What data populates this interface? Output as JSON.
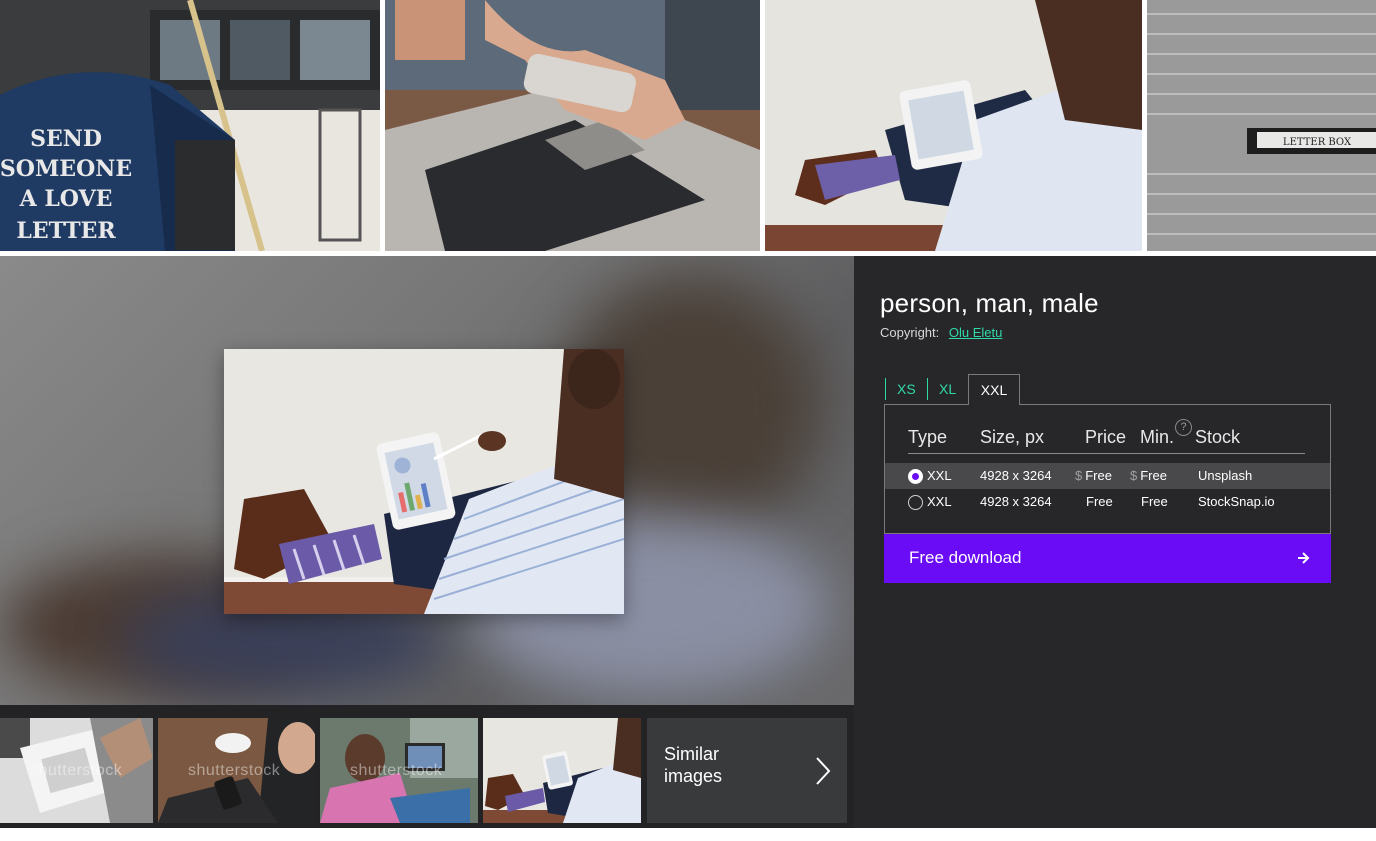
{
  "top_strip": [
    {
      "alt": "letter"
    },
    {
      "alt": "laptop"
    },
    {
      "alt": "tablet"
    },
    {
      "alt": "letterbox"
    }
  ],
  "photo_text": {
    "mailbox": [
      "SEND",
      "SOMEONE",
      "A LOVE",
      "LETTER"
    ],
    "letter_box": "LETTER  BOX"
  },
  "detail": {
    "title": "person, man, male",
    "copyright_label": "Copyright:",
    "author": "Olu Eletu",
    "tabs": [
      "XS",
      "XL",
      "XXL"
    ],
    "active_tab": "XXL",
    "columns": [
      "Type",
      "Size, px",
      "Price",
      "Min.",
      "Stock"
    ],
    "help_glyph": "?",
    "currency_symbol": "$",
    "rows": [
      {
        "type": "XXL",
        "size": "4928 x 3264",
        "price": "Free",
        "min": "Free",
        "stock": "Unsplash",
        "selected": true
      },
      {
        "type": "XXL",
        "size": "4928 x 3264",
        "price": "Free",
        "min": "Free",
        "stock": "StockSnap.io",
        "selected": false
      }
    ],
    "download_label": "Free download"
  },
  "thumbnails": {
    "watermark": "shutterstock",
    "similar_label": "Similar images"
  },
  "colors": {
    "accent_purple": "#6a0cf5",
    "accent_green": "#2fd9a8",
    "panel_bg": "#272729"
  },
  "icons": {
    "similar": "chevron-right-icon",
    "download": "arrow-right-icon",
    "help": "help-circle-icon"
  }
}
